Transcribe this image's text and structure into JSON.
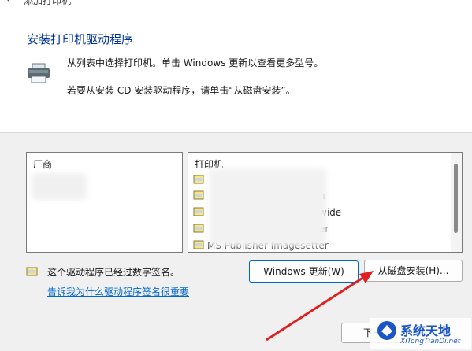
{
  "window": {
    "title": "添加打印机",
    "back_arrow": "←"
  },
  "header": {
    "heading": "安装打印机驱动程序",
    "line1": "从列表中选择打印机。单击 Windows 更新以查看更多型号。",
    "line2": "若要从安装 CD 安装驱动程序，请单击“从磁盘安装”。",
    "icon": "printer-icon"
  },
  "manufacturers": {
    "header": "厂商"
  },
  "printers": {
    "header": "打印机",
    "items": [
      {
        "text": ""
      },
      {
        "text": "n"
      },
      {
        "text": "wide"
      },
      {
        "text": "er"
      },
      {
        "text": "MS Publisher Imagesetter"
      }
    ]
  },
  "signature": {
    "text": "这个驱动程序已经过数字签名。",
    "link": "告诉我为什么驱动程序签名很重要",
    "icon": "signed-driver-icon"
  },
  "buttons": {
    "windows_update": "Windows 更新(W)",
    "have_disk": "从磁盘安装(H)...",
    "next": "下一"
  },
  "watermark": {
    "cn": "系统天地",
    "en": "XiTongTianDi.net"
  },
  "colors": {
    "heading": "#003399",
    "link": "#0066cc",
    "focus": "#0067c0",
    "annotation": "#e02020"
  }
}
